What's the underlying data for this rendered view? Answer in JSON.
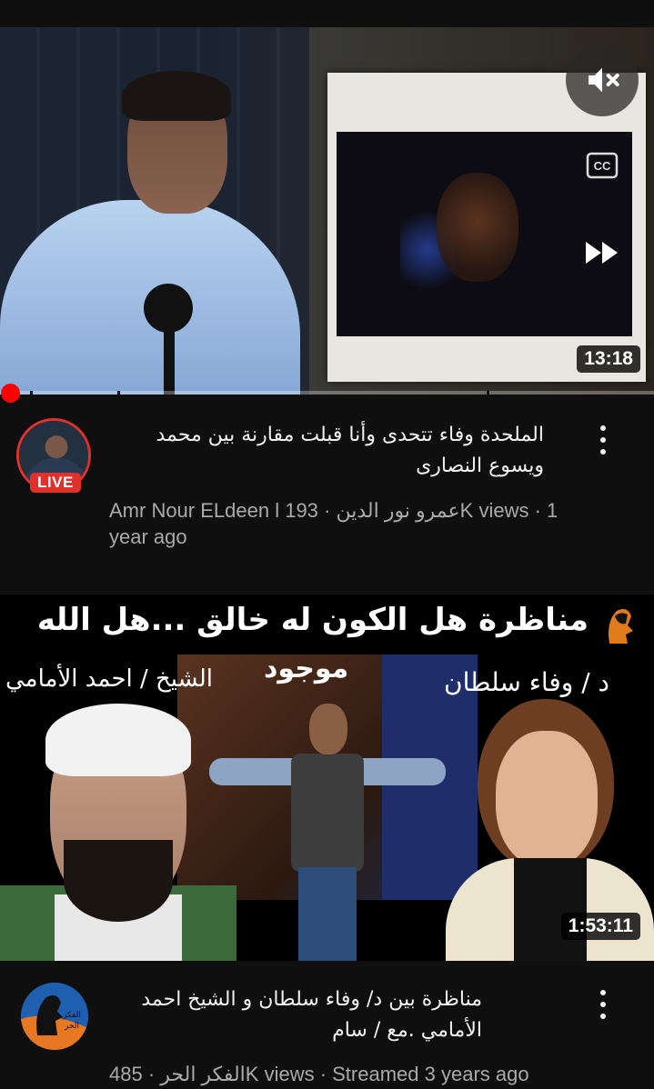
{
  "video1": {
    "duration": "13:18",
    "title": "الملحدة وفاء تتحدى وأنا قبلت مقارنة بين محمد ويسوع النصارى",
    "title_line1": "الملحدة وفاء تتحدى وأنا قبلت مقارنة بين محمد",
    "title_line2": "ويسوع النصارى",
    "meta_line1": "Amr Nour ELdeen l عمرو نور الدين · 193K views · 1",
    "meta_line2": "year ago",
    "channel": "Amr Nour ELdeen l عمرو نور الدين",
    "views": "193K views",
    "age": "1 year ago",
    "live_badge": "LIVE",
    "progress": 0.01,
    "controls": {
      "mute_icon": "volume-mute-icon",
      "cc_label": "CC",
      "ff_icon": "fast-forward-icon"
    }
  },
  "video2": {
    "duration": "1:53:11",
    "overlay": {
      "headline": "مناظرة هل الكون له خالق ...هل الله",
      "headline_2": "موجود",
      "left_label": "الشيخ / احمد الأمامي",
      "right_label": "د / وفاء سلطان",
      "logo_text": "الفكر الحر"
    },
    "title_line1": "مناظرة بين د/ وفاء سلطان و الشيخ احمد",
    "title_line2": "الأمامي .مع / سام",
    "meta_line": "الفكر الحر · 485K views · Streamed 3 years ago",
    "channel": "الفكر الحر",
    "avatar_text": "الفكر الحر",
    "views": "485K views",
    "age": "Streamed 3 years ago"
  },
  "colors": {
    "background": "#0f0f0f",
    "live_red": "#e0312c",
    "progress_red": "#ff0000",
    "meta_gray": "#aaaaaa"
  }
}
